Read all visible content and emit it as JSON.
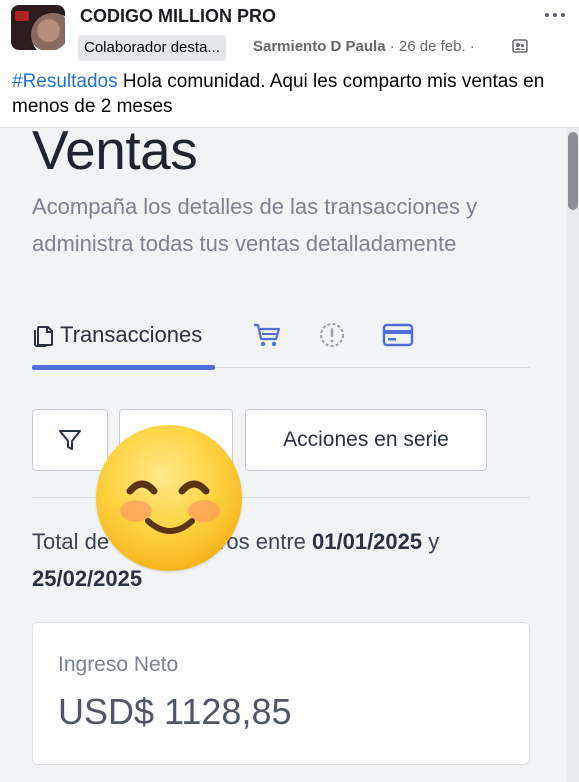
{
  "post": {
    "group_name": "CODIGO MILLION PRO",
    "role_badge": "Colaborador desta...",
    "author": "Sarmiento D Paula",
    "date": "26 de feb.",
    "separator": "·",
    "hashtag": "#Resultados",
    "text": " Hola comunidad. Aqui les comparto mis ventas en menos de 2 meses",
    "icons": [
      "more-dots-icon",
      "group-privacy-icon"
    ]
  },
  "panel": {
    "title": "Ventas",
    "description": "Acompaña los detalles de las transacciones y administra todas tus ventas detalladamente",
    "tabs": [
      {
        "label": "Transacciones",
        "icon": "copy-icon",
        "active": true
      },
      {
        "label": "",
        "icon": "cart-icon",
        "active": false
      },
      {
        "label": "",
        "icon": "alert-circle-icon",
        "active": false
      },
      {
        "label": "",
        "icon": "credit-card-icon",
        "active": false
      }
    ],
    "toolbar": {
      "filter_icon": "filter-icon",
      "bulk_actions_label": "Acciones en serie"
    },
    "summary": {
      "prefix": "Total de",
      "hidden_word": "ros entre",
      "date_from": "01/01/2025",
      "conjunction": "y",
      "date_to": "25/02/2025"
    },
    "stat": {
      "label": "Ingreso Neto",
      "value": "USD$ 1128,85"
    }
  },
  "overlay": {
    "emoji": "smiling-face-with-smiling-eyes-emoji"
  },
  "colors": {
    "accent": "#4f6ed8",
    "hashtag": "#216fdb",
    "muted_text": "#7b8291",
    "emoji_yellow": "#ffd23f"
  }
}
